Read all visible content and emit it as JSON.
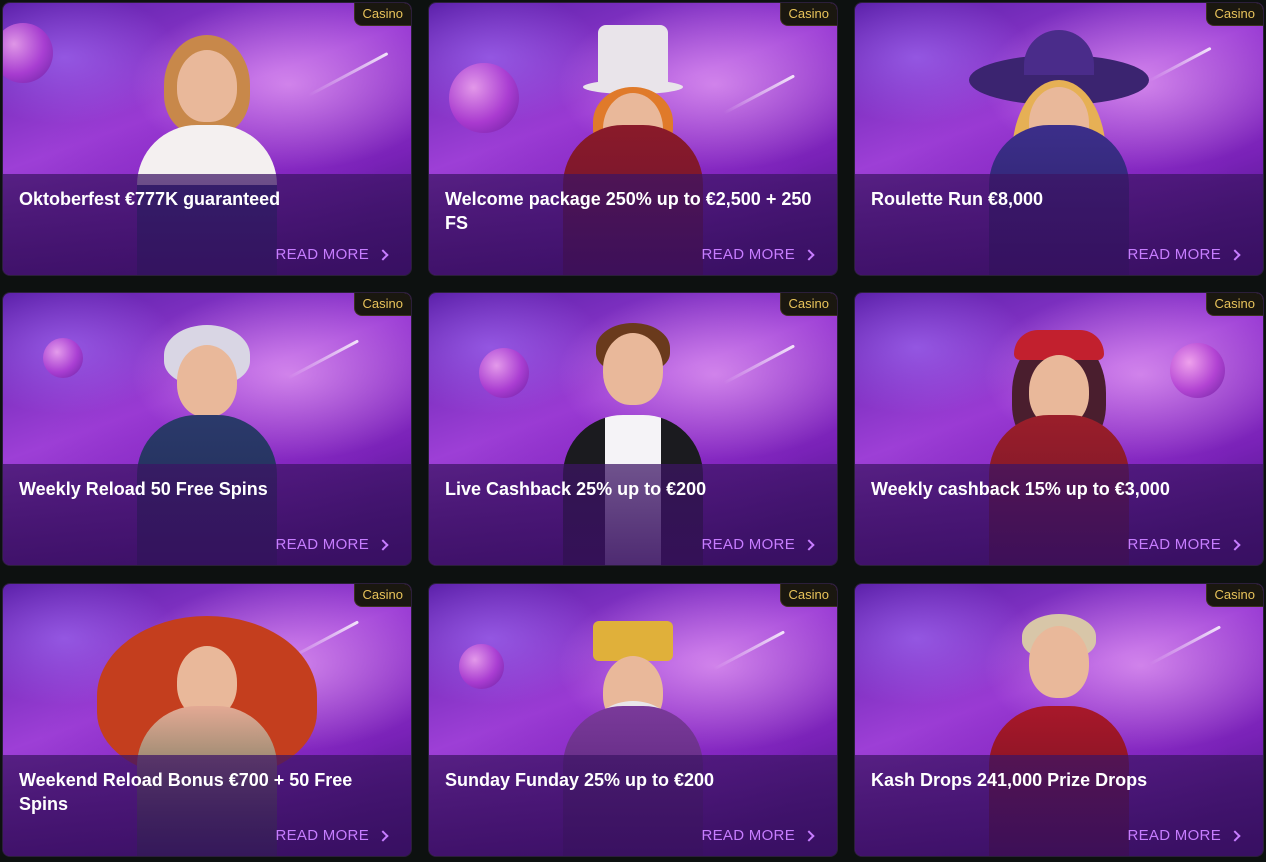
{
  "promotions": [
    {
      "title": "Oktoberfest €777K guaranteed",
      "badge": "Casino",
      "cta": "READ MORE",
      "character": "oktoberfest-waitress"
    },
    {
      "title": "Welcome package 250% up to €2,500 + 250 FS",
      "badge": "Casino",
      "cta": "READ MORE",
      "character": "top-hat-magician"
    },
    {
      "title": "Roulette Run €8,000",
      "badge": "Casino",
      "cta": "READ MORE",
      "character": "witch"
    },
    {
      "title": "Weekly Reload 50 Free Spins",
      "badge": "Casino",
      "cta": "READ MORE",
      "character": "boy-in-suit"
    },
    {
      "title": "Live Cashback 25% up to €200",
      "badge": "Casino",
      "cta": "READ MORE",
      "character": "card-dealer"
    },
    {
      "title": "Weekly cashback 15% up to €3,000",
      "badge": "Casino",
      "cta": "READ MORE",
      "character": "fortune-teller"
    },
    {
      "title": "Weekend Reload Bonus €700 + 50 Free Spins",
      "badge": "Casino",
      "cta": "READ MORE",
      "character": "red-haired-siren"
    },
    {
      "title": "Sunday Funday 25% up to €200",
      "badge": "Casino",
      "cta": "READ MORE",
      "character": "bearded-king"
    },
    {
      "title": "Kash Drops 241,000 Prize Drops",
      "badge": "Casino",
      "cta": "READ MORE",
      "character": "mustached-gentleman"
    }
  ],
  "colors": {
    "page_background": "#0d1110",
    "badge_text": "#e8c35a",
    "cta_text": "#c77dff",
    "title_text": "#ffffff"
  }
}
